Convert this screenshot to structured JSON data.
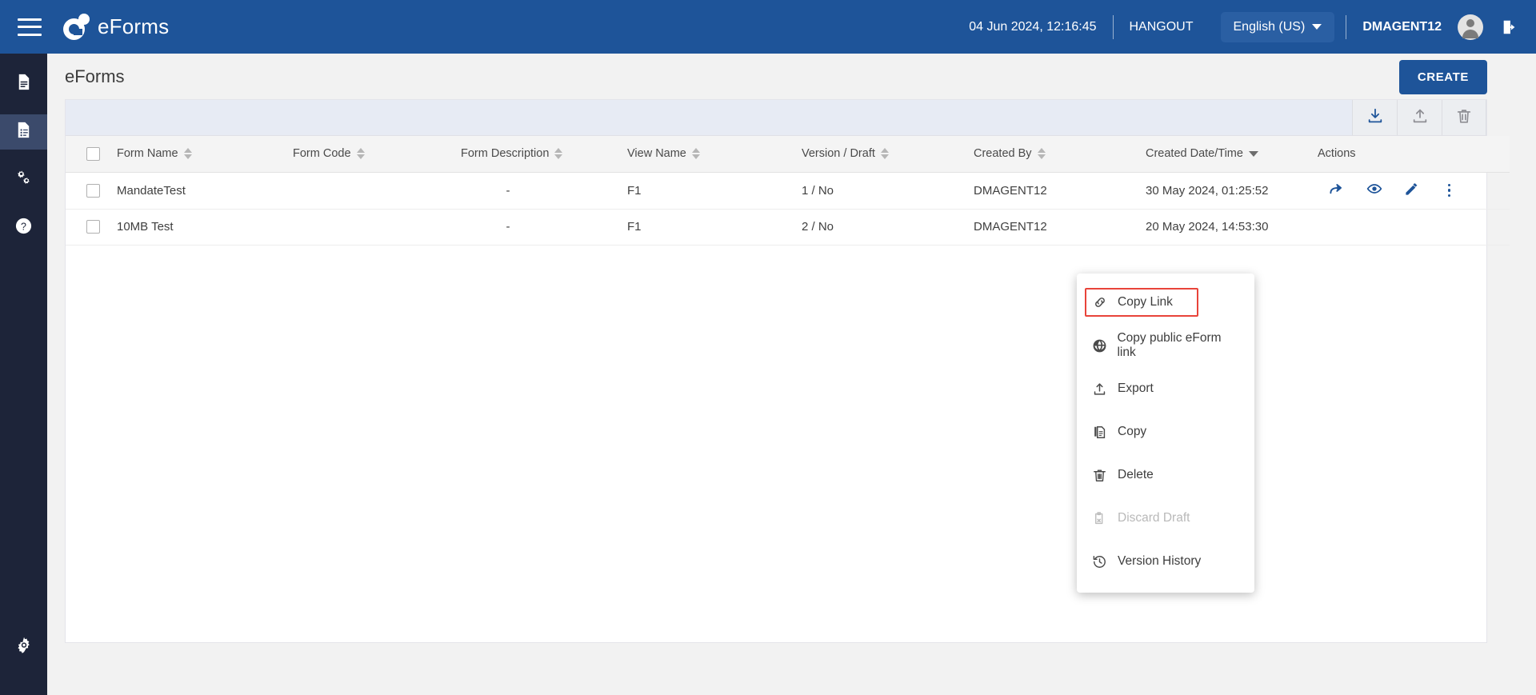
{
  "topbar": {
    "hamburger_name": "menu",
    "brand": "eForms",
    "datetime": "04 Jun 2024, 12:16:45",
    "hangout": "HANGOUT",
    "language": "English (US)",
    "username": "DMAGENT12",
    "brand_color": "#1e5499"
  },
  "sidebar": {
    "items": [
      {
        "name": "forms-icon",
        "icon": "document",
        "active": false
      },
      {
        "name": "eforms-icon",
        "icon": "document-list",
        "active": true
      },
      {
        "name": "settings-gears-icon",
        "icon": "gears",
        "active": false
      },
      {
        "name": "help-icon",
        "icon": "question-circle",
        "active": false
      }
    ],
    "bottom": {
      "name": "admin-settings-icon",
      "icon": "gear"
    }
  },
  "page": {
    "title": "eForms",
    "create_label": "CREATE"
  },
  "toolbar": {
    "buttons": [
      {
        "name": "download-icon",
        "label": "Download",
        "enabled": true
      },
      {
        "name": "upload-icon",
        "label": "Upload",
        "enabled": false
      },
      {
        "name": "delete-icon",
        "label": "Delete",
        "enabled": false
      }
    ]
  },
  "table": {
    "columns": [
      {
        "label": "",
        "sort": "none"
      },
      {
        "label": "Form Name",
        "sort": "both"
      },
      {
        "label": "Form Code",
        "sort": "both"
      },
      {
        "label": "Form Description",
        "sort": "both"
      },
      {
        "label": "View Name",
        "sort": "both"
      },
      {
        "label": "Version / Draft",
        "sort": "both"
      },
      {
        "label": "Created By",
        "sort": "both"
      },
      {
        "label": "Created Date/Time",
        "sort": "desc"
      },
      {
        "label": "Actions",
        "sort": "none"
      }
    ],
    "rows": [
      {
        "form_name": "MandateTest",
        "form_code": "",
        "form_description": "-",
        "view_name": "F1",
        "version_draft": "1 / No",
        "created_by": "DMAGENT12",
        "created_datetime": "30 May 2024, 01:25:52"
      },
      {
        "form_name": "10MB Test",
        "form_code": "",
        "form_description": "-",
        "view_name": "F1",
        "version_draft": "2 / No",
        "created_by": "DMAGENT12",
        "created_datetime": "20 May 2024, 14:53:30"
      }
    ],
    "row_actions": [
      {
        "name": "share-icon",
        "label": "Share"
      },
      {
        "name": "view-eye-icon",
        "label": "View"
      },
      {
        "name": "edit-pencil-icon",
        "label": "Edit"
      },
      {
        "name": "more-options-icon",
        "label": "More"
      }
    ]
  },
  "context_menu": {
    "items": [
      {
        "label": "Copy Link",
        "icon": "link-icon",
        "disabled": false,
        "highlighted": true
      },
      {
        "label": "Copy public eForm link",
        "icon": "globe-icon",
        "disabled": false,
        "highlighted": false
      },
      {
        "label": "Export",
        "icon": "export-upload-icon",
        "disabled": false,
        "highlighted": false
      },
      {
        "label": "Copy",
        "icon": "copy-icon",
        "disabled": false,
        "highlighted": false
      },
      {
        "label": "Delete",
        "icon": "trash-icon",
        "disabled": false,
        "highlighted": false
      },
      {
        "label": "Discard Draft",
        "icon": "discard-draft-icon",
        "disabled": true,
        "highlighted": false
      },
      {
        "label": "Version History",
        "icon": "history-clock-icon",
        "disabled": false,
        "highlighted": false
      }
    ],
    "highlight_color": "#e8443a"
  }
}
